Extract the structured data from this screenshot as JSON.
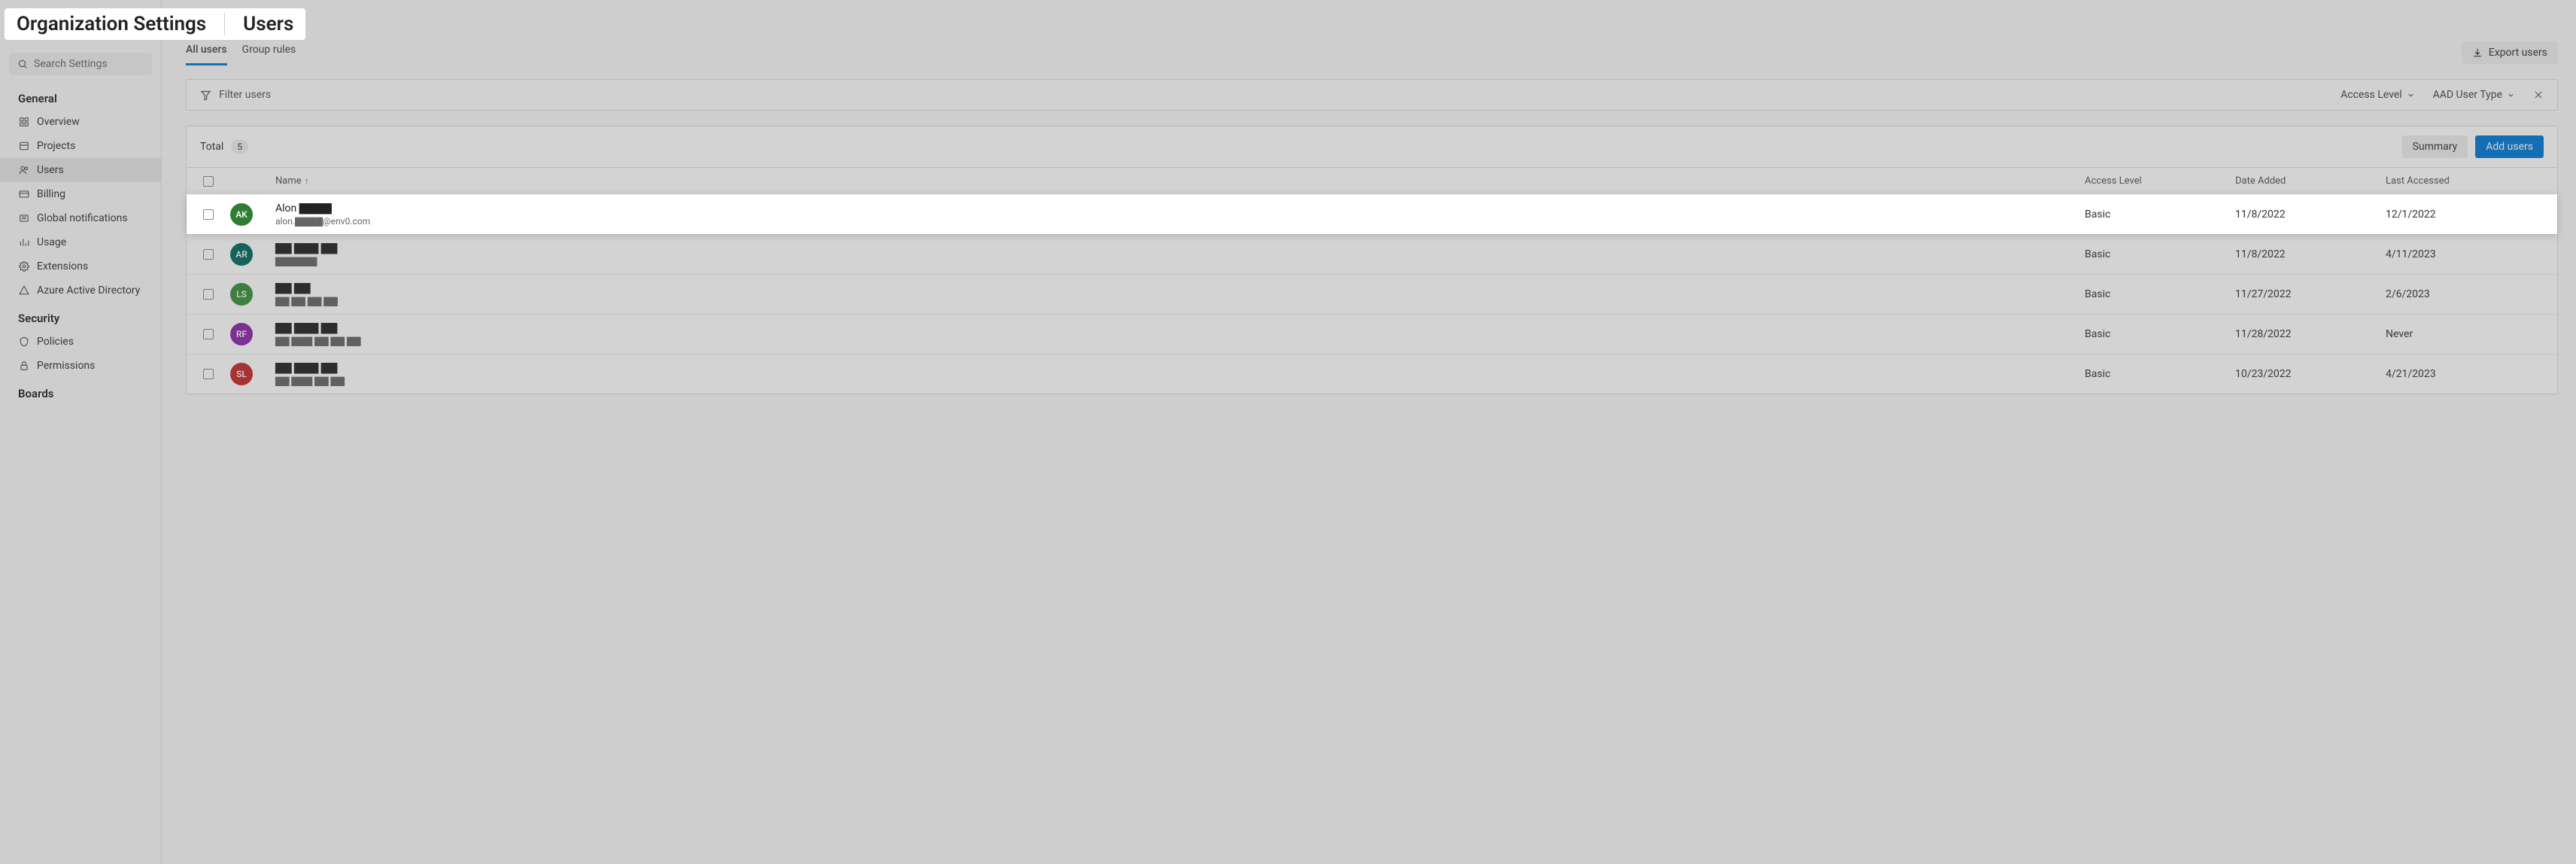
{
  "breadcrumb": {
    "org": "Organization Settings",
    "page": "Users"
  },
  "search": {
    "placeholder": "Search Settings"
  },
  "sidebar": {
    "sections": [
      {
        "title": "General",
        "items": [
          {
            "label": "Overview"
          },
          {
            "label": "Projects"
          },
          {
            "label": "Users",
            "active": true
          },
          {
            "label": "Billing"
          },
          {
            "label": "Global notifications"
          },
          {
            "label": "Usage"
          },
          {
            "label": "Extensions"
          },
          {
            "label": "Azure Active Directory"
          }
        ]
      },
      {
        "title": "Security",
        "items": [
          {
            "label": "Policies"
          },
          {
            "label": "Permissions"
          }
        ]
      },
      {
        "title": "Boards",
        "items": []
      }
    ]
  },
  "tabs": {
    "all_users": "All users",
    "group_rules": "Group rules"
  },
  "export_label": "Export users",
  "filter": {
    "label": "Filter users",
    "access_level": "Access Level",
    "aad_user_type": "AAD User Type"
  },
  "summary": {
    "total_label": "Total",
    "count": "5",
    "summary_btn": "Summary",
    "add_btn": "Add users"
  },
  "columns": {
    "name": "Name",
    "access_level": "Access Level",
    "date_added": "Date Added",
    "last_accessed": "Last Accessed"
  },
  "rows": [
    {
      "initials": "AK",
      "avatar_class": "av-ak",
      "name": "Alon ▇▇▇▇",
      "email": "alon.▇▇▇▇@env0.com",
      "access": "Basic",
      "added": "11/8/2022",
      "last": "12/1/2022",
      "highlight": true
    },
    {
      "initials": "AR",
      "avatar_class": "av-ar",
      "name": "▇▇ ▇▇▇ ▇▇",
      "email": "▇▇▇▇▇▇",
      "access": "Basic",
      "added": "11/8/2022",
      "last": "4/11/2023"
    },
    {
      "initials": "LS",
      "avatar_class": "av-ls",
      "name": "▇▇ ▇▇",
      "email": "▇▇ ▇▇ ▇▇ ▇▇",
      "access": "Basic",
      "added": "11/27/2022",
      "last": "2/6/2023"
    },
    {
      "initials": "RF",
      "avatar_class": "av-rf",
      "name": "▇▇ ▇▇▇ ▇▇",
      "email": "▇▇ ▇▇▇ ▇▇ ▇▇ ▇▇",
      "access": "Basic",
      "added": "11/28/2022",
      "last": "Never"
    },
    {
      "initials": "SL",
      "avatar_class": "av-sl",
      "name": "▇▇ ▇▇▇ ▇▇",
      "email": "▇▇ ▇▇▇ ▇▇ ▇▇",
      "access": "Basic",
      "added": "10/23/2022",
      "last": "4/21/2023"
    }
  ]
}
